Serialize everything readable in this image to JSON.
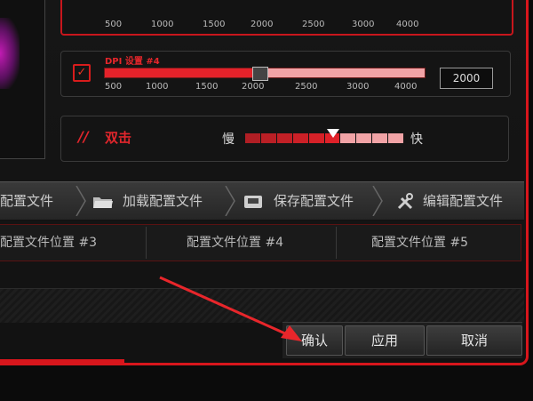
{
  "dpi_top": {
    "ticks": [
      "500",
      "1000",
      "1500",
      "2000",
      "2500",
      "3000",
      "4000"
    ]
  },
  "dpi4": {
    "title": "DPI 设置 #4",
    "checked_symbol": "✓",
    "ticks": [
      "500",
      "1000",
      "1500",
      "2000",
      "2500",
      "3000",
      "4000"
    ],
    "value": "2000",
    "level_fraction": 0.5
  },
  "double_click": {
    "prefix": "//",
    "label": "双击",
    "slow_label": "慢",
    "fast_label": "快",
    "segments": 10,
    "level_fraction": 0.55
  },
  "toolbar": {
    "items": [
      {
        "label": "配置文件",
        "icon": "folder-icon"
      },
      {
        "label": "加载配置文件",
        "icon": "folder-open-icon"
      },
      {
        "label": "保存配置文件",
        "icon": "save-icon"
      },
      {
        "label": "编辑配置文件",
        "icon": "tools-icon"
      }
    ]
  },
  "profiles": [
    "配置文件位置  #3",
    "配置文件位置  #4",
    "配置文件位置  #5"
  ],
  "buttons": {
    "confirm": "确认",
    "apply": "应用",
    "cancel": "取消"
  },
  "colors": {
    "accent": "#d8161c",
    "light_red": "#f1a3a6"
  }
}
